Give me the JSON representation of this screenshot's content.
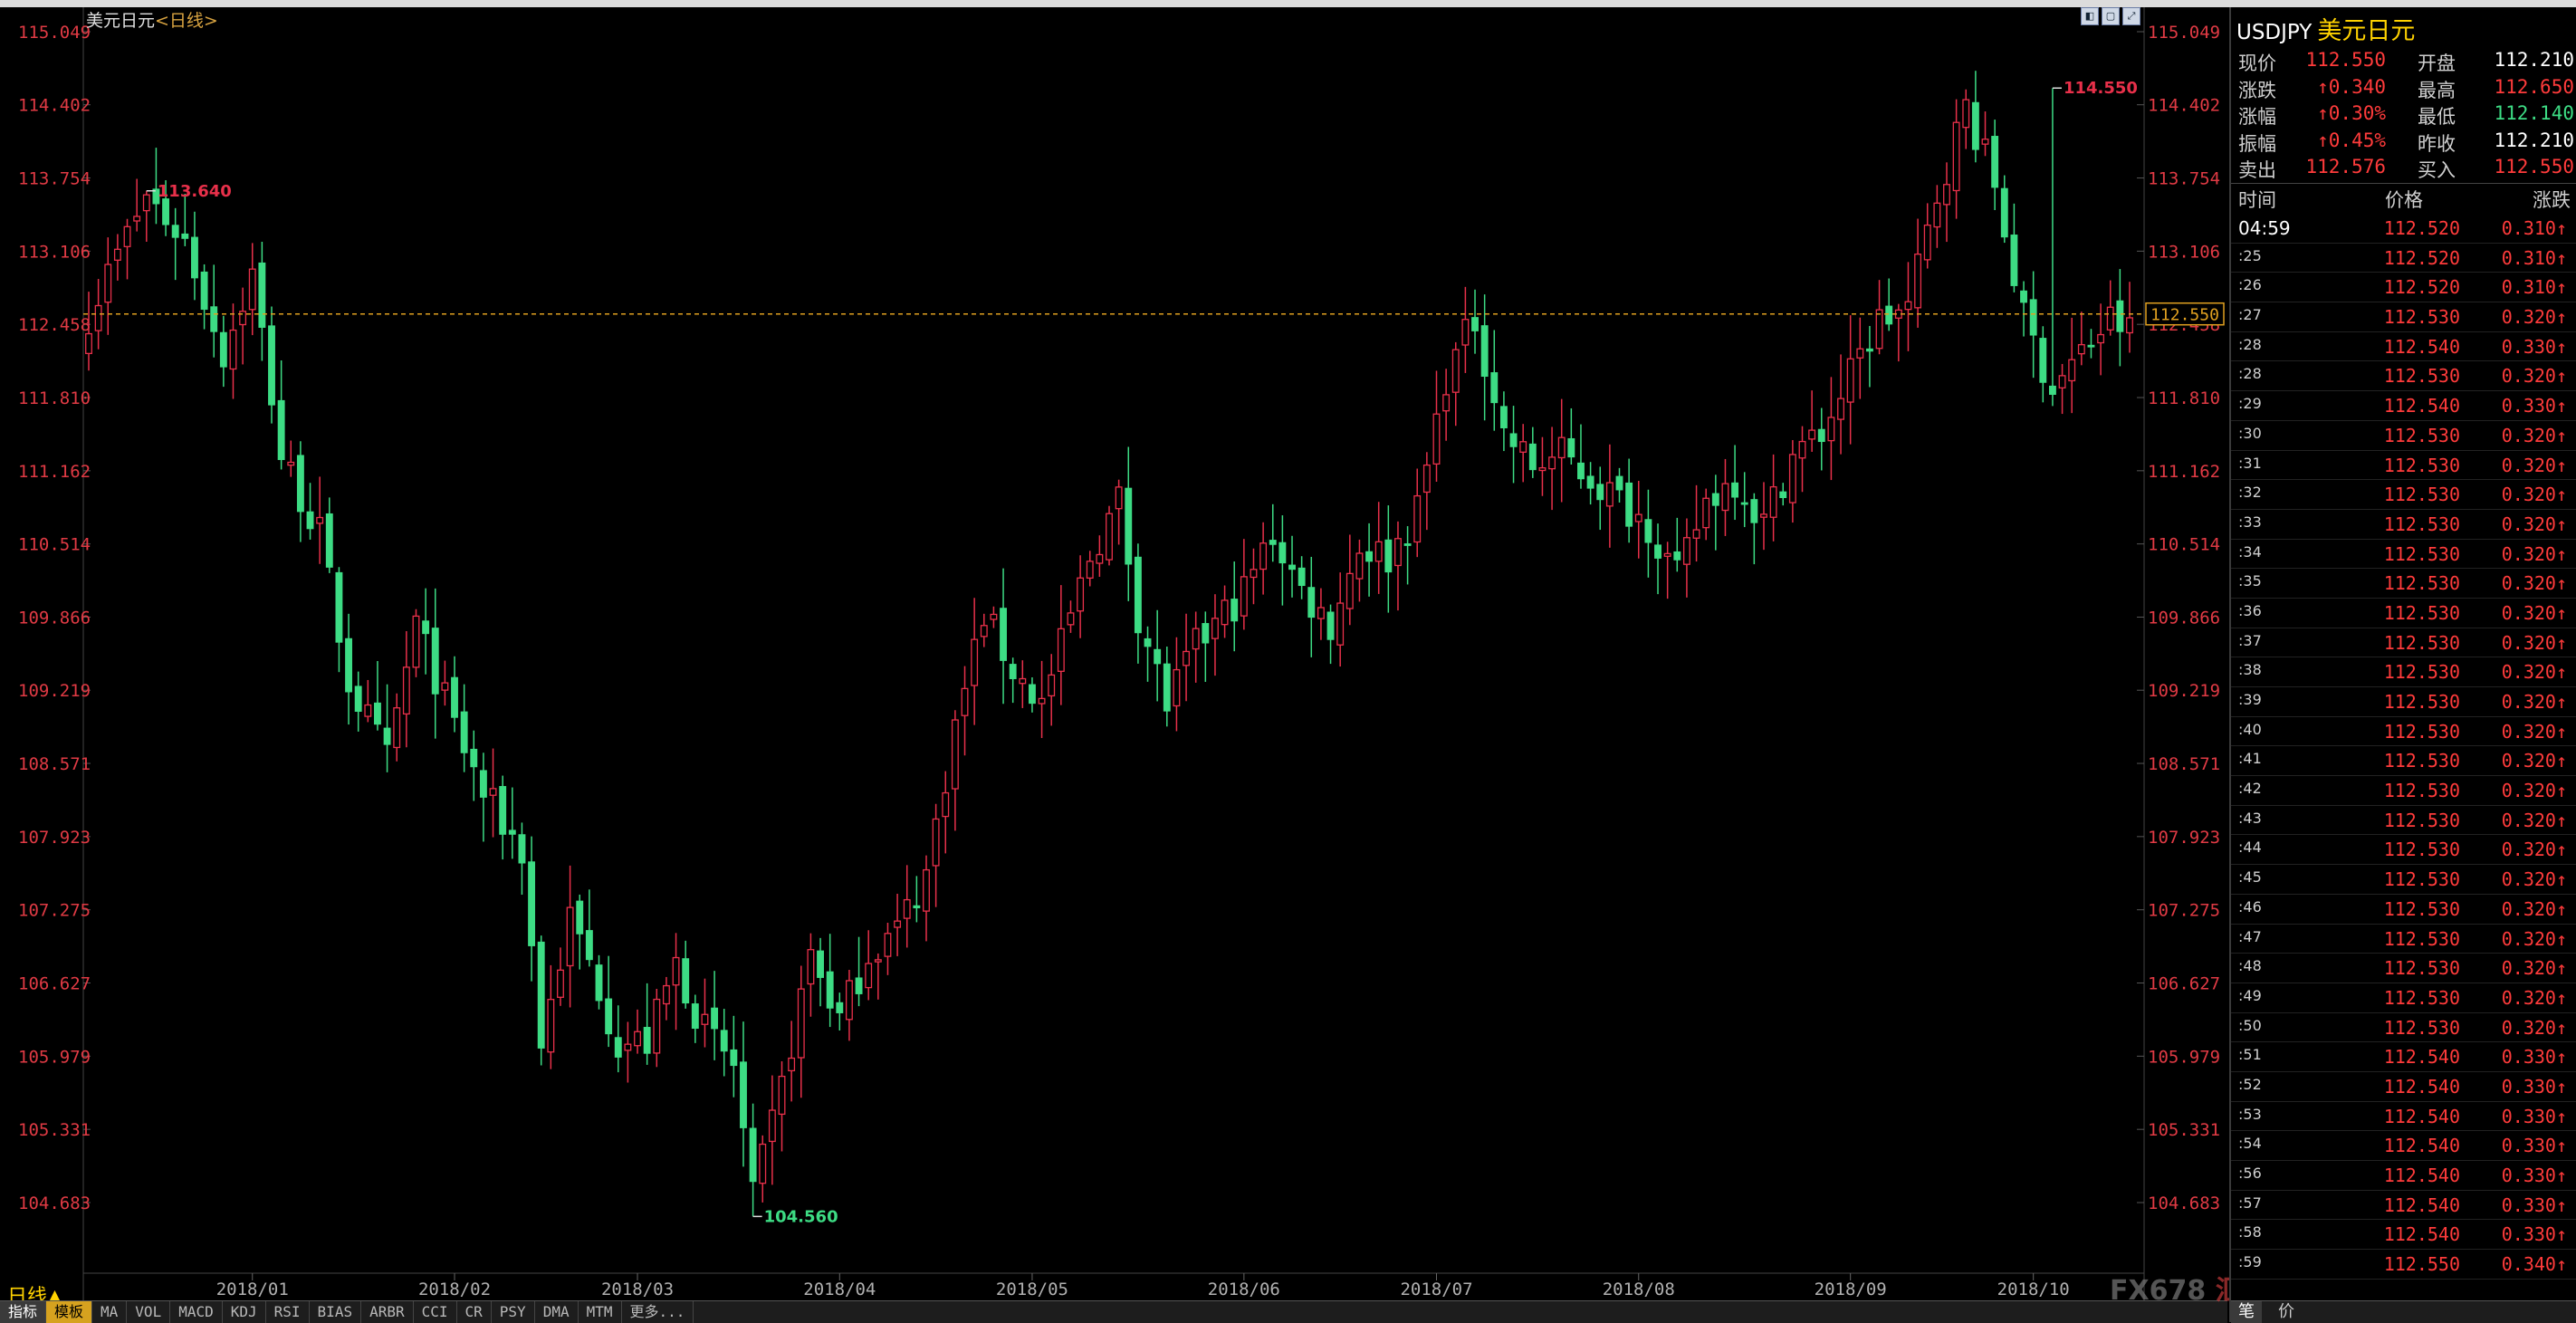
{
  "chart_title": {
    "main": "美元日元",
    "sub": "<日线>"
  },
  "period_label": "日线▲",
  "window_controls": [
    "◧",
    "▢",
    "⤢"
  ],
  "tabs": [
    "指标",
    "模板",
    "MA",
    "VOL",
    "MACD",
    "KDJ",
    "RSI",
    "BIAS",
    "ARBR",
    "CCI",
    "CR",
    "PSY",
    "DMA",
    "MTM",
    "更多..."
  ],
  "watermark": {
    "brand": "FX678",
    "cn": "汇通网"
  },
  "colors": {
    "up": "#e8304a",
    "down": "#3ddc84",
    "axis_text": "#e03a44",
    "grid": "#333333",
    "current": "#e0a020"
  },
  "chart_data": {
    "type": "candlestick",
    "y_ticks": [
      "115.049",
      "114.402",
      "113.754",
      "113.106",
      "112.458",
      "111.810",
      "111.162",
      "110.514",
      "109.866",
      "109.219",
      "108.571",
      "107.923",
      "107.275",
      "106.627",
      "105.979",
      "105.331",
      "104.683"
    ],
    "ylim": [
      104.683,
      115.049
    ],
    "x_tick_labels": [
      "2018/01",
      "2018/02",
      "2018/03",
      "2018/04",
      "2018/05",
      "2018/06",
      "2018/07",
      "2018/08",
      "2018/09",
      "2018/10"
    ],
    "x_tick_index": [
      17,
      38,
      57,
      78,
      98,
      120,
      140,
      161,
      183,
      202
    ],
    "n_bars": 213,
    "current_price": "112.550",
    "annotations": [
      {
        "text": "113.640",
        "index": 6,
        "value": 113.64,
        "kind": "high"
      },
      {
        "text": "114.550",
        "index": 204,
        "value": 114.55,
        "kind": "high"
      },
      {
        "text": "104.560",
        "index": 69,
        "value": 104.56,
        "kind": "low"
      }
    ],
    "anchors": [
      [
        0,
        112.55
      ],
      [
        6,
        113.6
      ],
      [
        10,
        113.2
      ],
      [
        14,
        112.2
      ],
      [
        17,
        112.9
      ],
      [
        20,
        111.3
      ],
      [
        24,
        110.6
      ],
      [
        27,
        109.3
      ],
      [
        31,
        108.6
      ],
      [
        34,
        109.8
      ],
      [
        38,
        108.9
      ],
      [
        41,
        108.3
      ],
      [
        45,
        107.8
      ],
      [
        47,
        106.1
      ],
      [
        50,
        107.2
      ],
      [
        53,
        106.6
      ],
      [
        55,
        106.1
      ],
      [
        58,
        106.1
      ],
      [
        61,
        106.8
      ],
      [
        64,
        106.2
      ],
      [
        67,
        105.9
      ],
      [
        69,
        104.7
      ],
      [
        72,
        105.7
      ],
      [
        75,
        106.9
      ],
      [
        78,
        106.3
      ],
      [
        81,
        106.9
      ],
      [
        84,
        107.1
      ],
      [
        87,
        107.6
      ],
      [
        90,
        108.9
      ],
      [
        93,
        109.9
      ],
      [
        96,
        109.4
      ],
      [
        99,
        109.1
      ],
      [
        101,
        109.6
      ],
      [
        104,
        110.4
      ],
      [
        107,
        110.9
      ],
      [
        109,
        109.9
      ],
      [
        112,
        109.1
      ],
      [
        115,
        109.6
      ],
      [
        117,
        109.8
      ],
      [
        120,
        110.1
      ],
      [
        123,
        110.6
      ],
      [
        126,
        110.1
      ],
      [
        129,
        109.8
      ],
      [
        132,
        110.5
      ],
      [
        135,
        110.4
      ],
      [
        138,
        110.8
      ],
      [
        141,
        112.0
      ],
      [
        144,
        112.5
      ],
      [
        147,
        111.5
      ],
      [
        150,
        111.2
      ],
      [
        153,
        111.3
      ],
      [
        156,
        111.1
      ],
      [
        159,
        110.9
      ],
      [
        162,
        110.7
      ],
      [
        165,
        110.2
      ],
      [
        168,
        110.9
      ],
      [
        171,
        111.1
      ],
      [
        174,
        110.7
      ],
      [
        177,
        111.3
      ],
      [
        180,
        111.5
      ],
      [
        183,
        112.0
      ],
      [
        186,
        112.5
      ],
      [
        189,
        112.6
      ],
      [
        192,
        113.6
      ],
      [
        195,
        114.4
      ],
      [
        198,
        113.7
      ],
      [
        201,
        112.5
      ],
      [
        204,
        111.9
      ],
      [
        207,
        112.2
      ],
      [
        210,
        112.5
      ],
      [
        212,
        112.4
      ]
    ]
  },
  "quote_panel": {
    "code": "USDJPY",
    "name": "美元日元",
    "rows": [
      {
        "l1": "现价",
        "v1": "112.550",
        "l2": "开盘",
        "v2": "112.210",
        "c2": "#ffffff"
      },
      {
        "l1": "涨跌",
        "v1": "↑0.340",
        "l2": "最高",
        "v2": "112.650",
        "c2": "#ff3b3b"
      },
      {
        "l1": "涨幅",
        "v1": "↑0.30%",
        "l2": "最低",
        "v2": "112.140",
        "c2": "#3ddc84"
      },
      {
        "l1": "振幅",
        "v1": "↑0.45%",
        "l2": "昨收",
        "v2": "112.210",
        "c2": "#ffffff"
      },
      {
        "l1": "卖出",
        "v1": "112.576",
        "l2": "买入",
        "v2": "112.550",
        "c2": "#ff3b3b"
      }
    ],
    "tick_header": {
      "time": "时间",
      "price": "价格",
      "change": "涨跌"
    },
    "ticks": [
      [
        "04:59",
        "112.520",
        "0.310↑"
      ],
      [
        ":25",
        "112.520",
        "0.310↑"
      ],
      [
        ":26",
        "112.520",
        "0.310↑"
      ],
      [
        ":27",
        "112.530",
        "0.320↑"
      ],
      [
        ":28",
        "112.540",
        "0.330↑"
      ],
      [
        ":28",
        "112.530",
        "0.320↑"
      ],
      [
        ":29",
        "112.540",
        "0.330↑"
      ],
      [
        ":30",
        "112.530",
        "0.320↑"
      ],
      [
        ":31",
        "112.530",
        "0.320↑"
      ],
      [
        ":32",
        "112.530",
        "0.320↑"
      ],
      [
        ":33",
        "112.530",
        "0.320↑"
      ],
      [
        ":34",
        "112.530",
        "0.320↑"
      ],
      [
        ":35",
        "112.530",
        "0.320↑"
      ],
      [
        ":36",
        "112.530",
        "0.320↑"
      ],
      [
        ":37",
        "112.530",
        "0.320↑"
      ],
      [
        ":38",
        "112.530",
        "0.320↑"
      ],
      [
        ":39",
        "112.530",
        "0.320↑"
      ],
      [
        ":40",
        "112.530",
        "0.320↑"
      ],
      [
        ":41",
        "112.530",
        "0.320↑"
      ],
      [
        ":42",
        "112.530",
        "0.320↑"
      ],
      [
        ":43",
        "112.530",
        "0.320↑"
      ],
      [
        ":44",
        "112.530",
        "0.320↑"
      ],
      [
        ":45",
        "112.530",
        "0.320↑"
      ],
      [
        ":46",
        "112.530",
        "0.320↑"
      ],
      [
        ":47",
        "112.530",
        "0.320↑"
      ],
      [
        ":48",
        "112.530",
        "0.320↑"
      ],
      [
        ":49",
        "112.530",
        "0.320↑"
      ],
      [
        ":50",
        "112.530",
        "0.320↑"
      ],
      [
        ":51",
        "112.540",
        "0.330↑"
      ],
      [
        ":52",
        "112.540",
        "0.330↑"
      ],
      [
        ":53",
        "112.540",
        "0.330↑"
      ],
      [
        ":54",
        "112.540",
        "0.330↑"
      ],
      [
        ":56",
        "112.540",
        "0.330↑"
      ],
      [
        ":57",
        "112.540",
        "0.330↑"
      ],
      [
        ":58",
        "112.540",
        "0.330↑"
      ],
      [
        ":59",
        "112.550",
        "0.340↑"
      ]
    ],
    "bottom_tabs": [
      "笔",
      "价"
    ]
  }
}
